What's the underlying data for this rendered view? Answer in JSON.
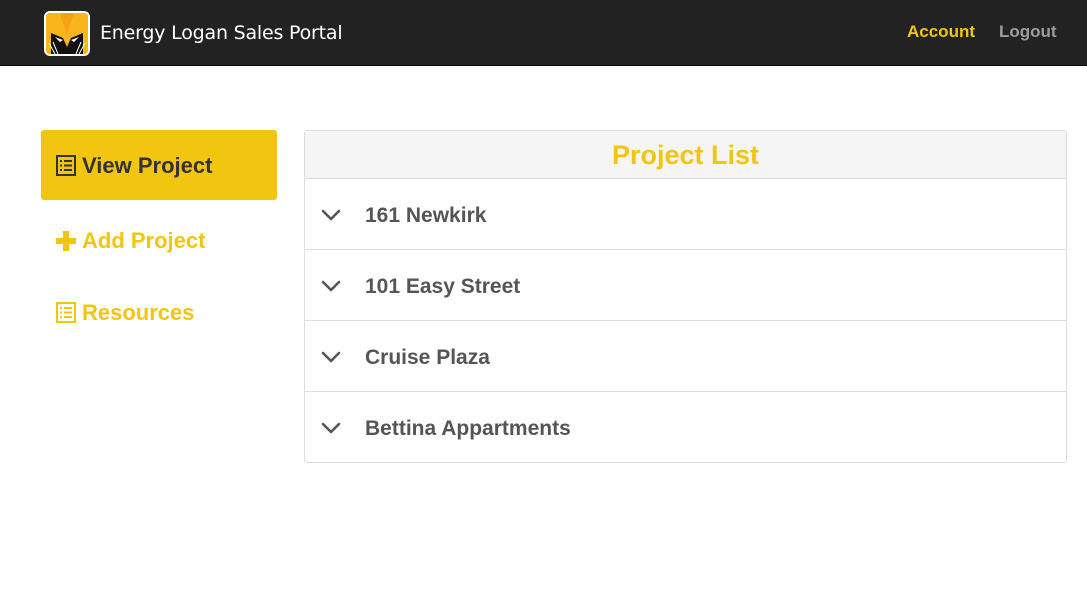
{
  "header": {
    "brand": "Energy Logan Sales Portal",
    "logo_icon": "wolverine-mask-logo",
    "account_label": "Account",
    "logout_label": "Logout"
  },
  "sidebar": {
    "items": [
      {
        "label": "View Project",
        "icon": "list-alt-icon",
        "active": true
      },
      {
        "label": "Add Project",
        "icon": "plus-icon",
        "active": false
      },
      {
        "label": "Resources",
        "icon": "list-alt-icon",
        "active": false
      }
    ]
  },
  "panel": {
    "title": "Project List",
    "projects": [
      {
        "name": "161 Newkirk"
      },
      {
        "name": "101 Easy Street"
      },
      {
        "name": "Cruise Plaza"
      },
      {
        "name": "Bettina Appartments"
      }
    ]
  },
  "colors": {
    "accent": "#f2c511",
    "navbar": "#222222",
    "text": "#555555",
    "panel_header": "#f5f5f5"
  }
}
